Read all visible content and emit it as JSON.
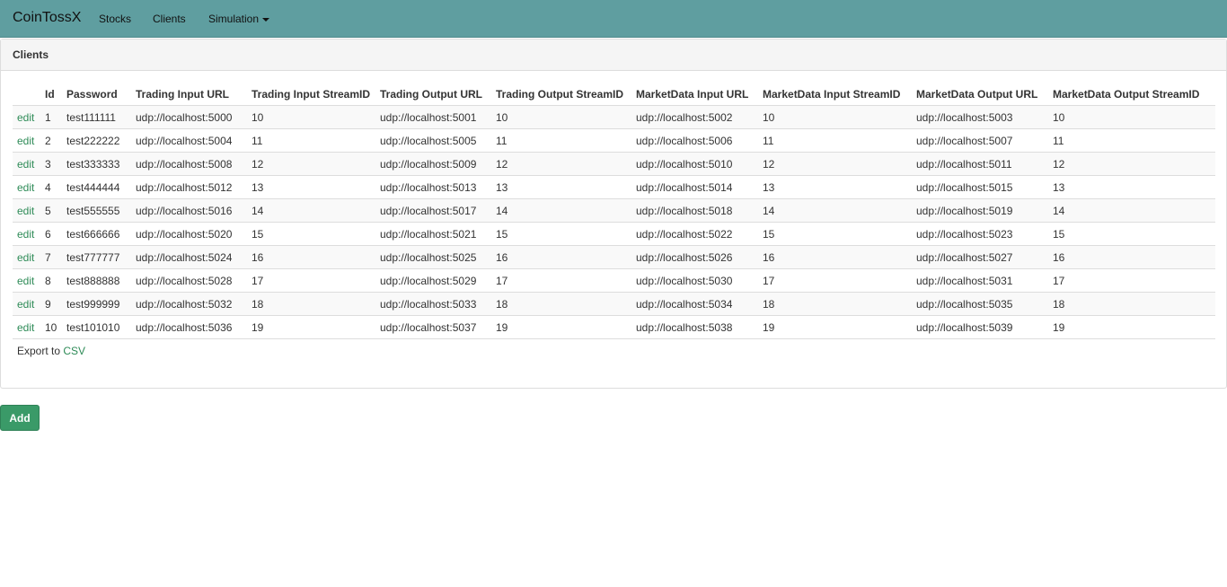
{
  "navbar": {
    "brand": "CoinTossX",
    "links": [
      "Stocks",
      "Clients",
      "Simulation"
    ]
  },
  "panel": {
    "title": "Clients"
  },
  "table": {
    "headers": [
      "",
      "Id",
      "Password",
      "Trading Input URL",
      "Trading Input StreamID",
      "Trading Output URL",
      "Trading Output StreamID",
      "MarketData Input URL",
      "MarketData Input StreamID",
      "MarketData Output URL",
      "MarketData Output StreamID"
    ],
    "edit_label": "edit",
    "rows": [
      [
        "1",
        "test111111",
        "udp://localhost:5000",
        "10",
        "udp://localhost:5001",
        "10",
        "udp://localhost:5002",
        "10",
        "udp://localhost:5003",
        "10"
      ],
      [
        "2",
        "test222222",
        "udp://localhost:5004",
        "11",
        "udp://localhost:5005",
        "11",
        "udp://localhost:5006",
        "11",
        "udp://localhost:5007",
        "11"
      ],
      [
        "3",
        "test333333",
        "udp://localhost:5008",
        "12",
        "udp://localhost:5009",
        "12",
        "udp://localhost:5010",
        "12",
        "udp://localhost:5011",
        "12"
      ],
      [
        "4",
        "test444444",
        "udp://localhost:5012",
        "13",
        "udp://localhost:5013",
        "13",
        "udp://localhost:5014",
        "13",
        "udp://localhost:5015",
        "13"
      ],
      [
        "5",
        "test555555",
        "udp://localhost:5016",
        "14",
        "udp://localhost:5017",
        "14",
        "udp://localhost:5018",
        "14",
        "udp://localhost:5019",
        "14"
      ],
      [
        "6",
        "test666666",
        "udp://localhost:5020",
        "15",
        "udp://localhost:5021",
        "15",
        "udp://localhost:5022",
        "15",
        "udp://localhost:5023",
        "15"
      ],
      [
        "7",
        "test777777",
        "udp://localhost:5024",
        "16",
        "udp://localhost:5025",
        "16",
        "udp://localhost:5026",
        "16",
        "udp://localhost:5027",
        "16"
      ],
      [
        "8",
        "test888888",
        "udp://localhost:5028",
        "17",
        "udp://localhost:5029",
        "17",
        "udp://localhost:5030",
        "17",
        "udp://localhost:5031",
        "17"
      ],
      [
        "9",
        "test999999",
        "udp://localhost:5032",
        "18",
        "udp://localhost:5033",
        "18",
        "udp://localhost:5034",
        "18",
        "udp://localhost:5035",
        "18"
      ],
      [
        "10",
        "test101010",
        "udp://localhost:5036",
        "19",
        "udp://localhost:5037",
        "19",
        "udp://localhost:5038",
        "19",
        "udp://localhost:5039",
        "19"
      ]
    ]
  },
  "export": {
    "prefix": "Export to",
    "link": "CSV"
  },
  "add_button": "Add",
  "colors": {
    "navbar": "#5f9ea0",
    "link": "#2e8b57",
    "add_button": "#3a9a68"
  }
}
